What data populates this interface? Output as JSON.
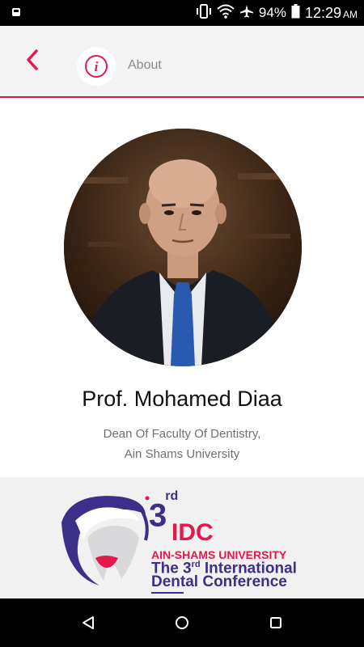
{
  "status_bar": {
    "battery": "94%",
    "time": "12:29",
    "ampm": "AM",
    "icons": [
      "notification-icon",
      "vibrate-icon",
      "wifi-icon",
      "airplane-icon",
      "battery-icon"
    ]
  },
  "header": {
    "title": "About",
    "back_icon": "chevron-left-icon",
    "info_icon": "info-icon",
    "accent": "#e3184d"
  },
  "profile": {
    "name": "Prof. Mohamed Diaa",
    "role_line1": "Dean Of Faculty Of Dentistry,",
    "role_line2": "Ain Shams University"
  },
  "banner": {
    "logo_prefix": "3",
    "logo_sup": "rd",
    "logo_word": "IDC",
    "university": "AIN-SHAMS UNIVERSITY",
    "conference_line1_pre": "The 3",
    "conference_line1_sup": "rd",
    "conference_line1_post": " International",
    "conference_line2": "Dental Conference",
    "colors": {
      "primary": "#3c2f8a",
      "accent": "#e3184d"
    }
  },
  "nav": {
    "icons": [
      "back-triangle-icon",
      "home-circle-icon",
      "recents-square-icon"
    ]
  }
}
